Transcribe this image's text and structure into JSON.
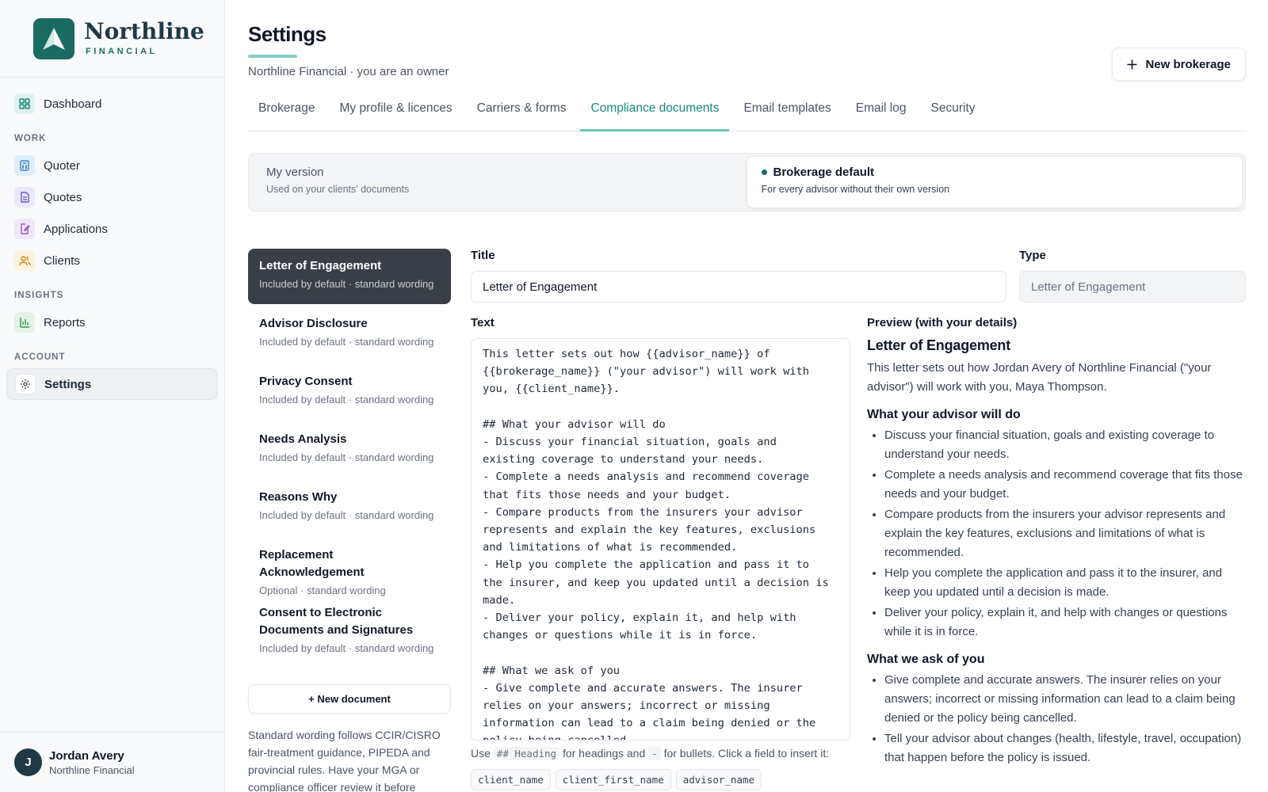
{
  "brand": {
    "name": "Northline",
    "sub": "FINANCIAL"
  },
  "nav": {
    "dashboard": "Dashboard",
    "work_label": "WORK",
    "quoter": "Quoter",
    "quotes": "Quotes",
    "applications": "Applications",
    "clients": "Clients",
    "insights_label": "INSIGHTS",
    "reports": "Reports",
    "account_label": "ACCOUNT",
    "settings": "Settings"
  },
  "user": {
    "initial": "J",
    "name": "Jordan Avery",
    "org": "Northline Financial"
  },
  "page": {
    "title": "Settings",
    "subtitle": "Northline Financial · you are an owner",
    "new_button": "New brokerage"
  },
  "tabs": [
    "Brokerage",
    "My profile & licences",
    "Carriers & forms",
    "Compliance documents",
    "Email templates",
    "Email log",
    "Security"
  ],
  "active_tab": "Compliance documents",
  "segments": [
    {
      "title": "My version",
      "desc": "Used on your clients' documents"
    },
    {
      "title": "Brokerage default",
      "desc": "For every advisor without their own version"
    }
  ],
  "documents": [
    {
      "name": "Letter of Engagement",
      "meta": "Included by default · standard wording"
    },
    {
      "name": "Advisor Disclosure",
      "meta": "Included by default · standard wording"
    },
    {
      "name": "Privacy Consent",
      "meta": "Included by default · standard wording"
    },
    {
      "name": "Needs Analysis",
      "meta": "Included by default · standard wording"
    },
    {
      "name": "Reasons Why",
      "meta": "Included by default · standard wording"
    },
    {
      "name": "Replacement Acknowledgement",
      "meta": "Optional · standard wording"
    },
    {
      "name": "Consent to Electronic Documents and Signatures",
      "meta": "Included by default · standard wording"
    }
  ],
  "new_document": "+ New document",
  "note": "Standard wording follows CCIR/CISRO fair-treatment guidance, PIPEDA and provincial rules. Have your MGA or compliance officer review it before",
  "editor": {
    "title_label": "Title",
    "title_value": "Letter of Engagement",
    "type_label": "Type",
    "type_value": "Letter of Engagement",
    "text_label": "Text",
    "text_value": "This letter sets out how {{advisor_name}} of\n{{brokerage_name}} (\"your advisor\") will work with\nyou, {{client_name}}.\n\n## What your advisor will do\n- Discuss your financial situation, goals and\nexisting coverage to understand your needs.\n- Complete a needs analysis and recommend coverage\nthat fits those needs and your budget.\n- Compare products from the insurers your advisor\nrepresents and explain the key features, exclusions\nand limitations of what is recommended.\n- Help you complete the application and pass it to\nthe insurer, and keep you updated until a decision is\nmade.\n- Deliver your policy, explain it, and help with\nchanges or questions while it is in force.\n\n## What we ask of you\n- Give complete and accurate answers. The insurer\nrelies on your answers; incorrect or missing\ninformation can lead to a claim being denied or the\npolicy being cancelled.",
    "hint_use": "Use",
    "hint_code1": "## Heading",
    "hint_mid": "for headings and",
    "hint_code2": "-",
    "hint_end": "for bullets. Click a field to insert it:",
    "chips": [
      "client_name",
      "client_first_name",
      "advisor_name"
    ]
  },
  "preview": {
    "label": "Preview (with your details)",
    "title": "Letter of Engagement",
    "intro": "This letter sets out how Jordan Avery of Northline Financial (\"your advisor\") will work with you, Maya Thompson.",
    "h1": "What your advisor will do",
    "list1": [
      "Discuss your financial situation, goals and existing coverage to understand your needs.",
      "Complete a needs analysis and recommend coverage that fits those needs and your budget.",
      "Compare products from the insurers your advisor represents and explain the key features, exclusions and limitations of what is recommended.",
      "Help you complete the application and pass it to the insurer, and keep you updated until a decision is made.",
      "Deliver your policy, explain it, and help with changes or questions while it is in force."
    ],
    "h2": "What we ask of you",
    "list2": [
      "Give complete and accurate answers. The insurer relies on your answers; incorrect or missing information can lead to a claim being denied or the policy being cancelled.",
      "Tell your advisor about changes (health, lifestyle, travel, occupation) that happen before the policy is issued."
    ]
  },
  "colors": {
    "brand": "#1a6b60",
    "accent": "#1a8a7c",
    "dark_item": "#3a3f47"
  }
}
